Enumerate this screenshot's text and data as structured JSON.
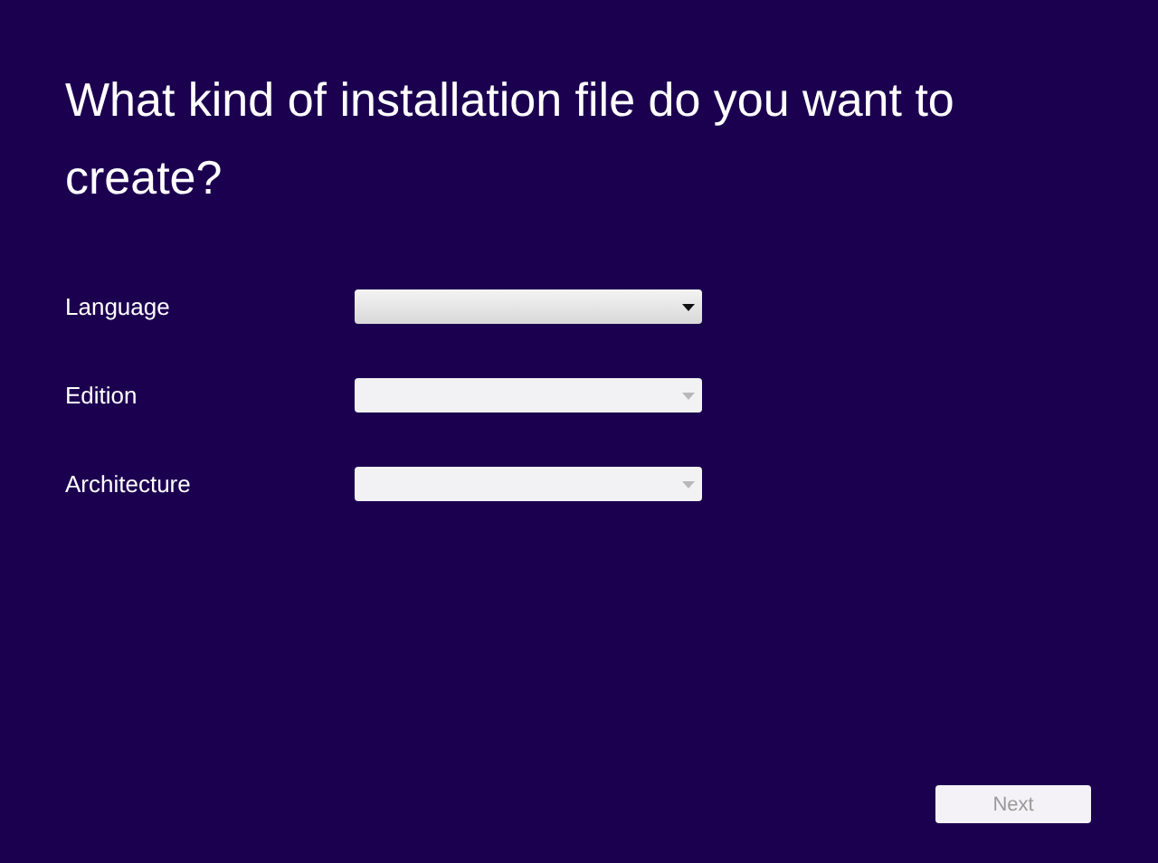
{
  "title": "What kind of installation file do you want to create?",
  "fields": [
    {
      "label": "Language",
      "disabled": false
    },
    {
      "label": "Edition",
      "disabled": true
    },
    {
      "label": "Architecture",
      "disabled": true
    }
  ],
  "next_button": {
    "label": "Next",
    "disabled": true
  }
}
